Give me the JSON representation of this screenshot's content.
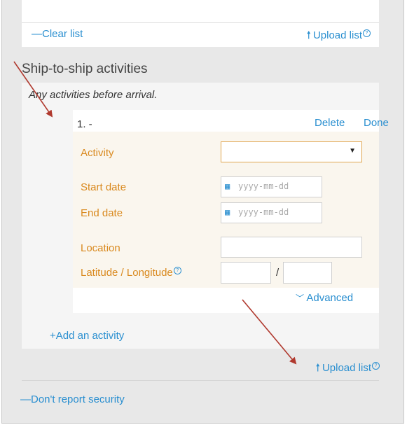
{
  "top_card": {
    "clear_list": "—Clear list",
    "upload_list": "Upload list"
  },
  "section": {
    "title": "Ship-to-ship activities",
    "note": "Any activities before arrival."
  },
  "activity_item": {
    "number": "1.  -",
    "delete": "Delete",
    "done": "Done",
    "fields": {
      "activity_label": "Activity",
      "activity_value": "",
      "start_date_label": "Start date",
      "start_date_placeholder": "yyyy-mm-dd",
      "end_date_label": "End date",
      "end_date_placeholder": "yyyy-mm-dd",
      "location_label": "Location",
      "location_value": "",
      "latlon_label": "Latitude / Longitude",
      "latitude_value": "",
      "separator": "/",
      "longitude_value": ""
    },
    "advanced": "Advanced"
  },
  "add_activity": "+Add an activity",
  "upload_list_bottom": "Upload list",
  "dont_report_security": "—Don't report security",
  "icons": {
    "upload": "upload-arrow-icon",
    "help": "help-circle-icon",
    "calendar": "calendar-icon",
    "dropdown": "dropdown-caret-icon",
    "chevron": "chevron-down-icon"
  },
  "colors": {
    "link": "#2a8fd0",
    "label": "#d9891e",
    "annotation_arrow": "#b0392e"
  }
}
